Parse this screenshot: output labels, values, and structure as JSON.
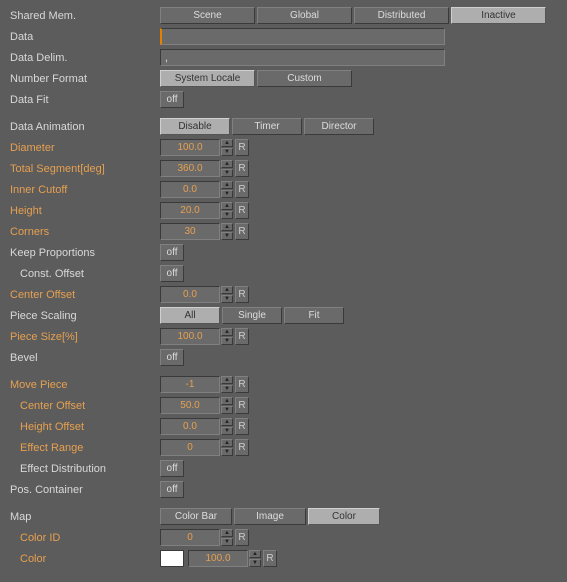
{
  "sharedMem": {
    "label": "Shared Mem.",
    "options": [
      "Scene",
      "Global",
      "Distributed",
      "Inactive"
    ],
    "active": 3
  },
  "data": {
    "label": "Data",
    "value": ""
  },
  "dataDelim": {
    "label": "Data Delim.",
    "value": ","
  },
  "numberFormat": {
    "label": "Number Format",
    "options": [
      "System Locale",
      "Custom"
    ],
    "active": 0
  },
  "dataFit": {
    "label": "Data Fit",
    "value": "off"
  },
  "dataAnimation": {
    "label": "Data Animation",
    "options": [
      "Disable",
      "Timer",
      "Director"
    ],
    "active": 0
  },
  "diameter": {
    "label": "Diameter",
    "value": "100.0"
  },
  "totalSegment": {
    "label": "Total Segment[deg]",
    "value": "360.0"
  },
  "innerCutoff": {
    "label": "Inner Cutoff",
    "value": "0.0"
  },
  "height": {
    "label": "Height",
    "value": "20.0"
  },
  "corners": {
    "label": "Corners",
    "value": "30"
  },
  "keepProportions": {
    "label": "Keep Proportions",
    "value": "off"
  },
  "constOffset": {
    "label": "Const. Offset",
    "value": "off"
  },
  "centerOffset": {
    "label": "Center Offset",
    "value": "0.0"
  },
  "pieceScaling": {
    "label": "Piece Scaling",
    "options": [
      "All",
      "Single",
      "Fit"
    ],
    "active": 0
  },
  "pieceSize": {
    "label": "Piece Size[%]",
    "value": "100.0"
  },
  "bevel": {
    "label": "Bevel",
    "value": "off"
  },
  "movePiece": {
    "label": "Move Piece",
    "value": "-1"
  },
  "mpCenterOffset": {
    "label": "Center Offset",
    "value": "50.0"
  },
  "mpHeightOffset": {
    "label": "Height Offset",
    "value": "0.0"
  },
  "mpEffectRange": {
    "label": "Effect Range",
    "value": "0"
  },
  "mpEffectDist": {
    "label": "Effect Distribution",
    "value": "off"
  },
  "posContainer": {
    "label": "Pos. Container",
    "value": "off"
  },
  "map": {
    "label": "Map",
    "options": [
      "Color Bar",
      "Image",
      "Color"
    ],
    "active": 2
  },
  "colorId": {
    "label": "Color ID",
    "value": "0"
  },
  "color": {
    "label": "Color",
    "swatch": "#ffffff",
    "value": "100.0"
  },
  "resetLabel": "R"
}
